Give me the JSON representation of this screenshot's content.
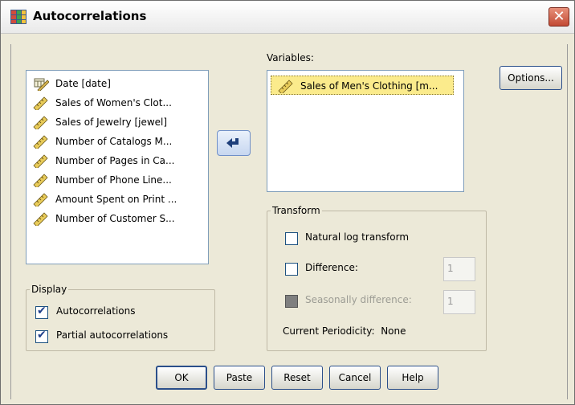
{
  "window": {
    "title": "Autocorrelations"
  },
  "source_list": {
    "items": [
      {
        "label": "Date [date]",
        "icon": "date-variable-icon"
      },
      {
        "label": "Sales of Women's Clot...",
        "icon": "scale-variable-icon"
      },
      {
        "label": "Sales of Jewelry [jewel]",
        "icon": "scale-variable-icon"
      },
      {
        "label": "Number of Catalogs M...",
        "icon": "scale-variable-icon"
      },
      {
        "label": "Number of Pages in Ca...",
        "icon": "scale-variable-icon"
      },
      {
        "label": "Number of Phone Line...",
        "icon": "scale-variable-icon"
      },
      {
        "label": "Amount Spent on Print ...",
        "icon": "scale-variable-icon"
      },
      {
        "label": "Number of Customer S...",
        "icon": "scale-variable-icon"
      }
    ]
  },
  "variables": {
    "label": "Variables:",
    "items": [
      {
        "label": "Sales of Men's Clothing [m...",
        "icon": "scale-variable-icon",
        "selected": true
      }
    ]
  },
  "options_button": "Options...",
  "transform": {
    "legend": "Transform",
    "natural_log": {
      "label": "Natural log transform",
      "checked": false
    },
    "difference": {
      "label": "Difference:",
      "checked": false,
      "value": "1"
    },
    "seasonal_difference": {
      "label": "Seasonally difference:",
      "checked": false,
      "disabled": true,
      "value": "1"
    },
    "periodicity_label": "Current Periodicity:",
    "periodicity_value": "None"
  },
  "display": {
    "legend": "Display",
    "autocorrelations": {
      "label": "Autocorrelations",
      "checked": true
    },
    "partial": {
      "label": "Partial autocorrelations",
      "checked": true
    }
  },
  "buttons": {
    "ok": "OK",
    "paste": "Paste",
    "reset": "Reset",
    "cancel": "Cancel",
    "help": "Help"
  },
  "colors": {
    "selection": "#fbeb8c",
    "accent": "#2b4f8a",
    "close": "#c24a34"
  }
}
